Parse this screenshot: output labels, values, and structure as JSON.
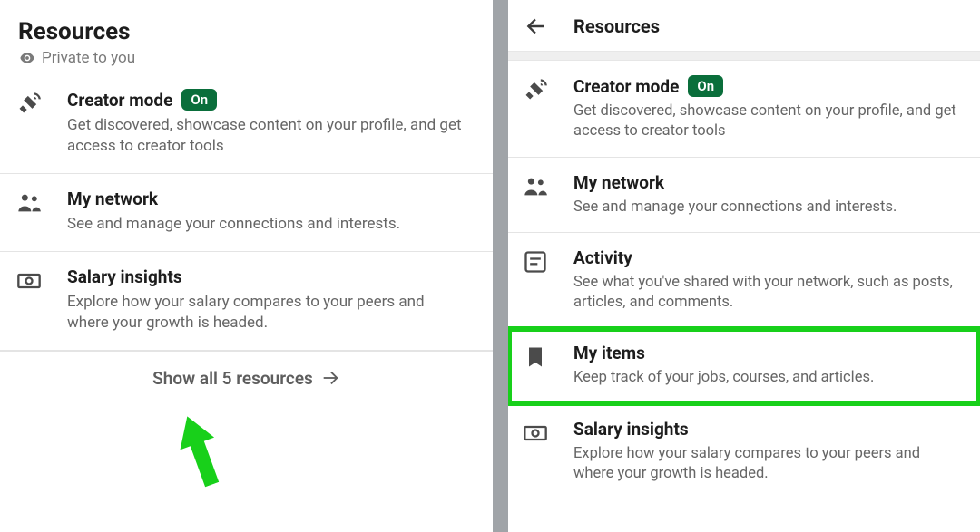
{
  "left": {
    "title": "Resources",
    "private_label": "Private to you",
    "items": [
      {
        "icon": "satellite",
        "title": "Creator mode",
        "badge": "On",
        "desc": "Get discovered, showcase content on your profile, and get access to creator tools"
      },
      {
        "icon": "network",
        "title": "My network",
        "desc": "See and manage your connections and interests."
      },
      {
        "icon": "money",
        "title": "Salary insights",
        "desc": "Explore how your salary compares to your peers and where your growth is headed."
      }
    ],
    "show_all": "Show all 5 resources"
  },
  "right": {
    "title": "Resources",
    "items": [
      {
        "icon": "satellite",
        "title": "Creator mode",
        "badge": "On",
        "desc": "Get discovered, showcase content on your profile, and get access to creator tools"
      },
      {
        "icon": "network",
        "title": "My network",
        "desc": "See and manage your connections and interests."
      },
      {
        "icon": "activity",
        "title": "Activity",
        "desc": "See what you've shared with your network, such as posts, articles, and comments."
      },
      {
        "icon": "bookmark",
        "title": "My items",
        "desc": "Keep track of your jobs, courses, and articles.",
        "highlight": true
      },
      {
        "icon": "money",
        "title": "Salary insights",
        "desc": "Explore how your salary compares to your peers and where your growth is headed."
      }
    ]
  }
}
